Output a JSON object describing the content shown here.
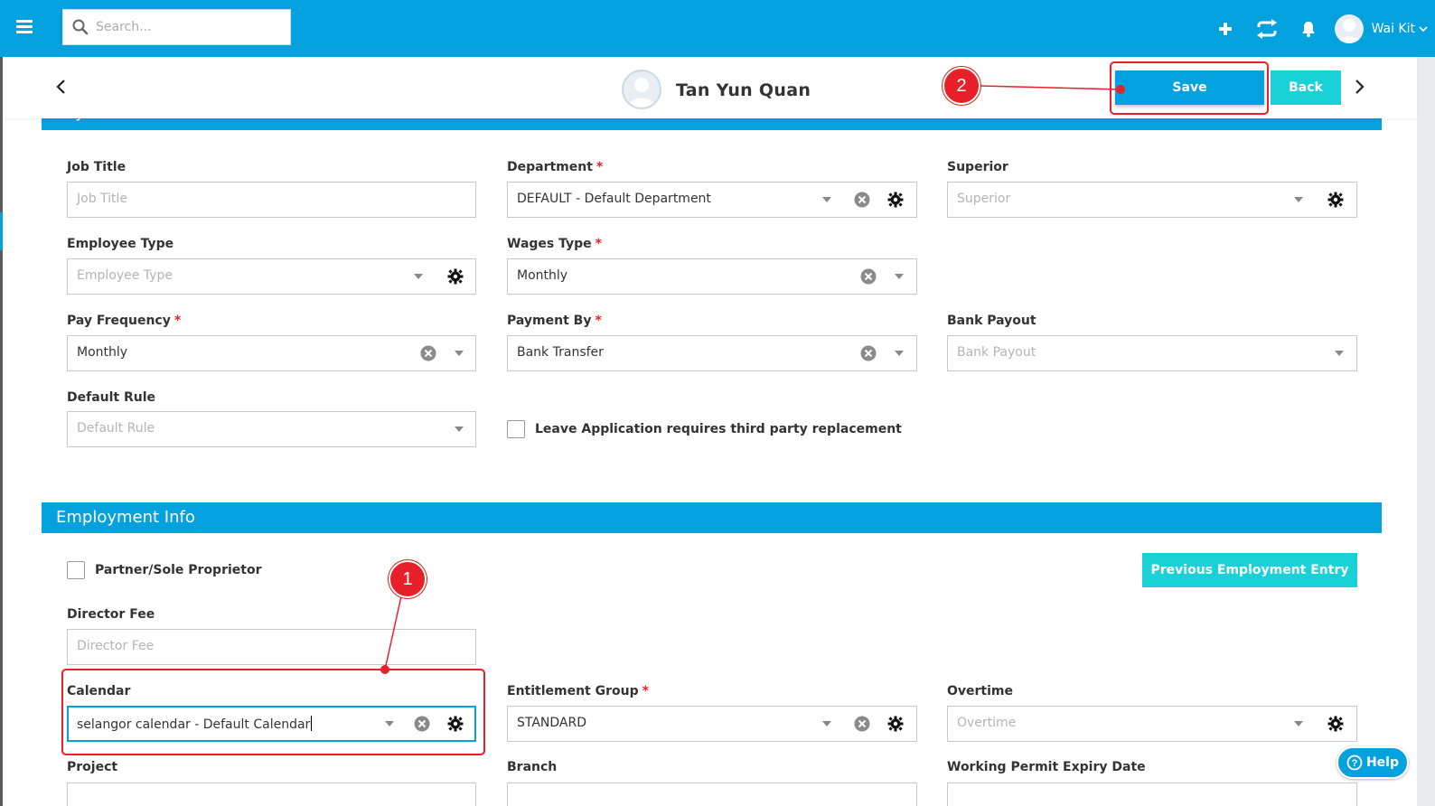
{
  "topbar": {
    "search_placeholder": "Search...",
    "user_name": "Wai Kit",
    "icons": [
      "menu-icon",
      "search-icon",
      "plus-icon",
      "sync-icon",
      "bell-icon",
      "avatar",
      "chevron-down-icon"
    ]
  },
  "header": {
    "employee_name": "Tan Yun Quan",
    "save_label": "Save",
    "back_label": "Back"
  },
  "payroll_section": {
    "title": "Payroll Information",
    "fields": {
      "job_title": {
        "label": "Job Title",
        "placeholder": "Job Title",
        "value": ""
      },
      "department": {
        "label": "Department",
        "required": true,
        "value": "DEFAULT - Default Department"
      },
      "superior": {
        "label": "Superior",
        "placeholder": "Superior",
        "value": ""
      },
      "employee_type": {
        "label": "Employee Type",
        "placeholder": "Employee Type",
        "value": ""
      },
      "wages_type": {
        "label": "Wages Type",
        "required": true,
        "value": "Monthly"
      },
      "pay_frequency": {
        "label": "Pay Frequency",
        "required": true,
        "value": "Monthly"
      },
      "payment_by": {
        "label": "Payment By",
        "required": true,
        "value": "Bank Transfer"
      },
      "bank_payout": {
        "label": "Bank Payout",
        "placeholder": "Bank Payout",
        "value": ""
      },
      "default_rule": {
        "label": "Default Rule",
        "placeholder": "Default Rule",
        "value": ""
      },
      "leave_replacement": {
        "label": "Leave Application requires third party replacement",
        "checked": false
      }
    }
  },
  "employment_section": {
    "title": "Employment Info",
    "partner_label": "Partner/Sole Proprietor",
    "partner_checked": false,
    "previous_employment_label": "Previous Employment Entry",
    "fields": {
      "director_fee": {
        "label": "Director Fee",
        "placeholder": "Director Fee",
        "value": ""
      },
      "calendar": {
        "label": "Calendar",
        "value": "selangor calendar - Default Calendar"
      },
      "entitlement_group": {
        "label": "Entitlement Group",
        "required": true,
        "value": "STANDARD"
      },
      "overtime": {
        "label": "Overtime",
        "placeholder": "Overtime",
        "value": ""
      },
      "project": {
        "label": "Project"
      },
      "branch": {
        "label": "Branch"
      },
      "working_permit": {
        "label": "Working Permit Expiry Date"
      }
    }
  },
  "help_label": "Help",
  "annotations": {
    "step1": "1",
    "step2": "2",
    "color": "#e8202a"
  },
  "colors": {
    "primary": "#04a1df",
    "accent": "#1ad1d8",
    "required": "#e8202a"
  }
}
